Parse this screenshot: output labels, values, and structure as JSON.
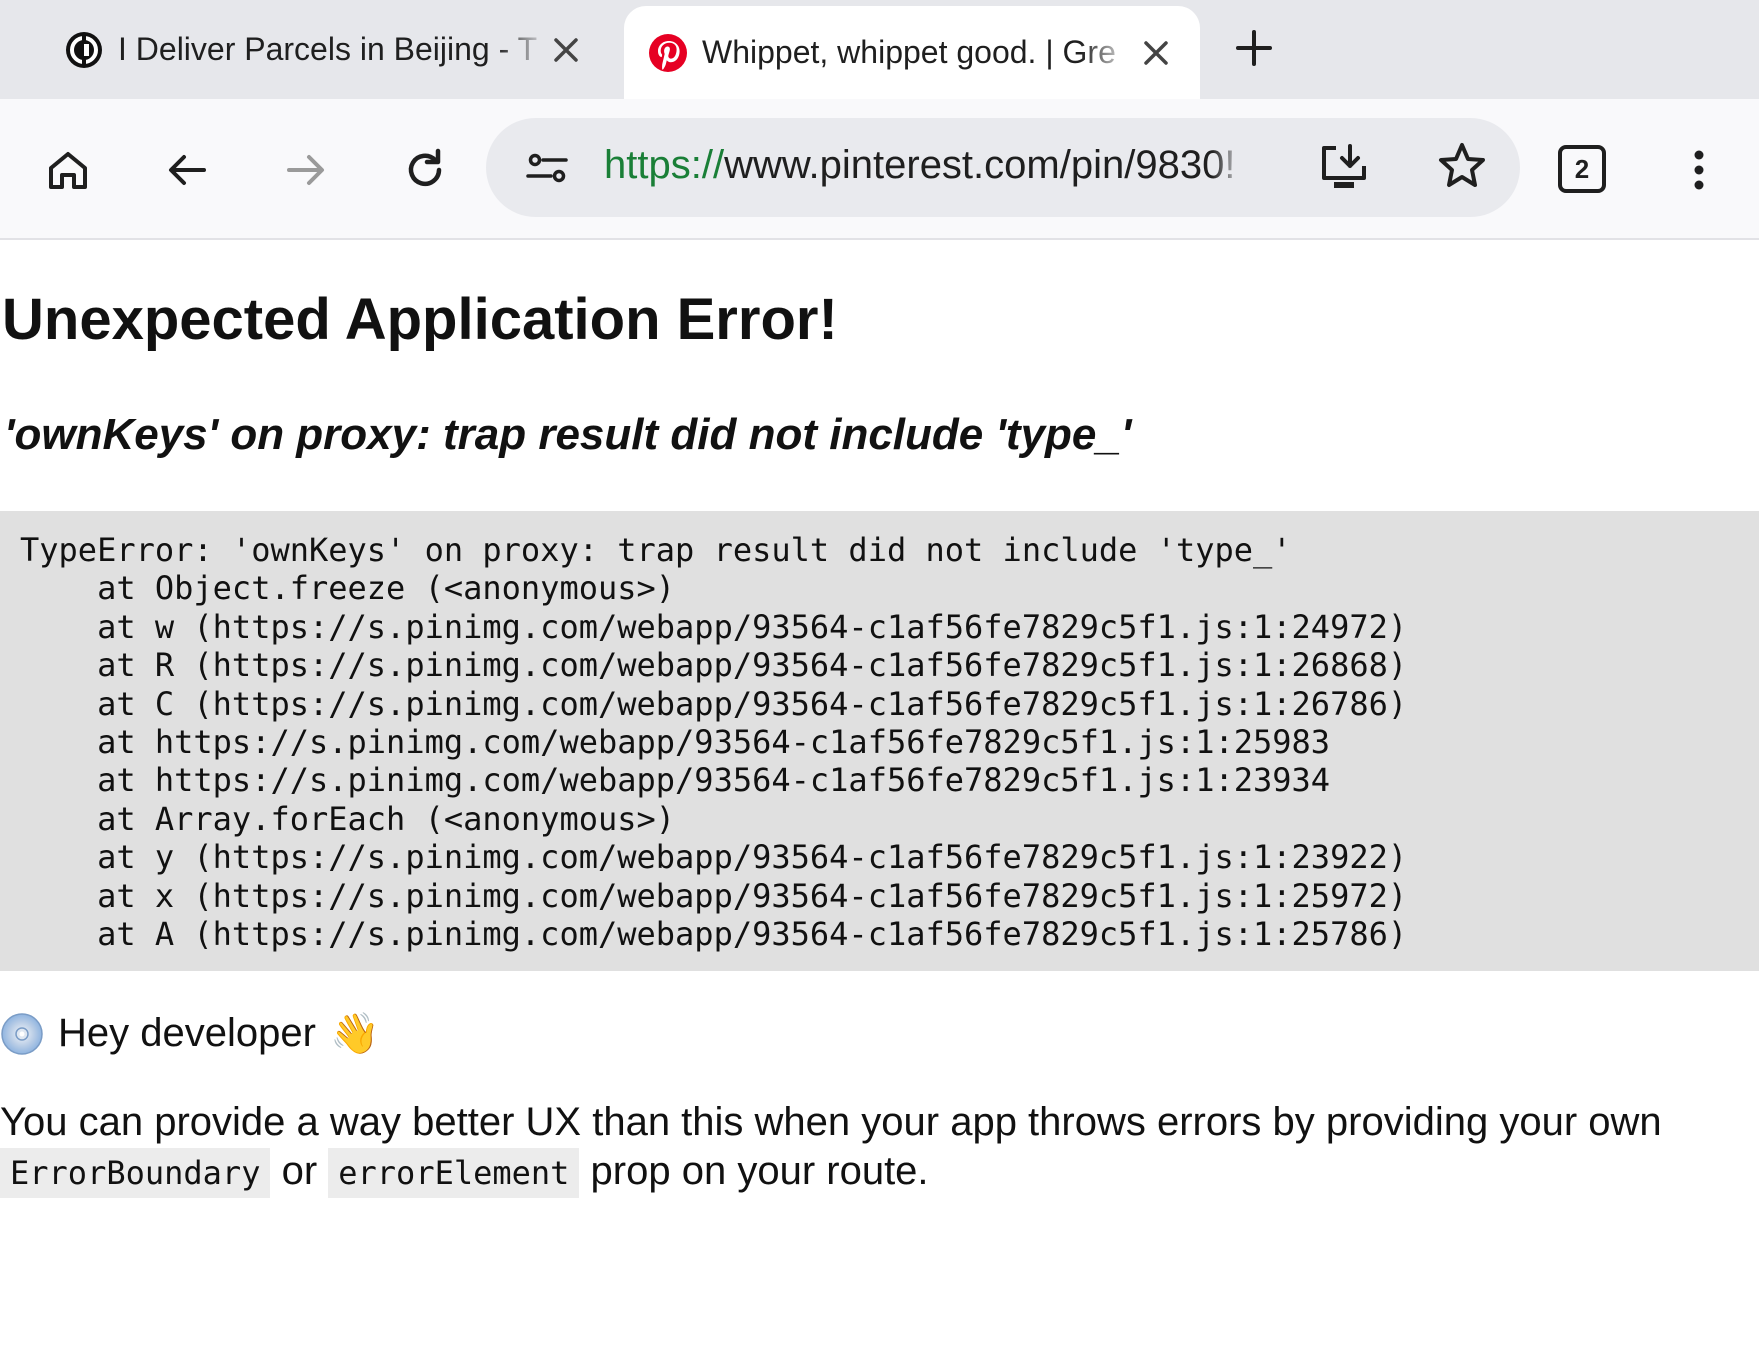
{
  "tabs": [
    {
      "title": "I Deliver Parcels in Beijing - T",
      "favicon": "site-logo-icon",
      "active": false
    },
    {
      "title": "Whippet, whippet good. | Gre",
      "favicon": "pinterest-logo-icon",
      "active": true
    }
  ],
  "toolbar": {
    "url_scheme": "https://",
    "url_rest": "www.pinterest.com/pin/9830!",
    "tab_count": "2"
  },
  "error": {
    "title": "Unexpected Application Error!",
    "message": "'ownKeys' on proxy: trap result did not include 'type_'",
    "stack": "TypeError: 'ownKeys' on proxy: trap result did not include 'type_'\n    at Object.freeze (<anonymous>)\n    at w (https://s.pinimg.com/webapp/93564-c1af56fe7829c5f1.js:1:24972)\n    at R (https://s.pinimg.com/webapp/93564-c1af56fe7829c5f1.js:1:26868)\n    at C (https://s.pinimg.com/webapp/93564-c1af56fe7829c5f1.js:1:26786)\n    at https://s.pinimg.com/webapp/93564-c1af56fe7829c5f1.js:1:25983\n    at https://s.pinimg.com/webapp/93564-c1af56fe7829c5f1.js:1:23934\n    at Array.forEach (<anonymous>)\n    at y (https://s.pinimg.com/webapp/93564-c1af56fe7829c5f1.js:1:23922)\n    at x (https://s.pinimg.com/webapp/93564-c1af56fe7829c5f1.js:1:25972)\n    at A (https://s.pinimg.com/webapp/93564-c1af56fe7829c5f1.js:1:25786)"
  },
  "developer": {
    "greeting": "Hey developer",
    "wave_emoji": "👋",
    "text_before": "You can provide a way better UX than this when your app throws errors by providing your own ",
    "code1": "ErrorBoundary",
    "text_mid": " or ",
    "code2": "errorElement",
    "text_after": " prop on your route."
  }
}
